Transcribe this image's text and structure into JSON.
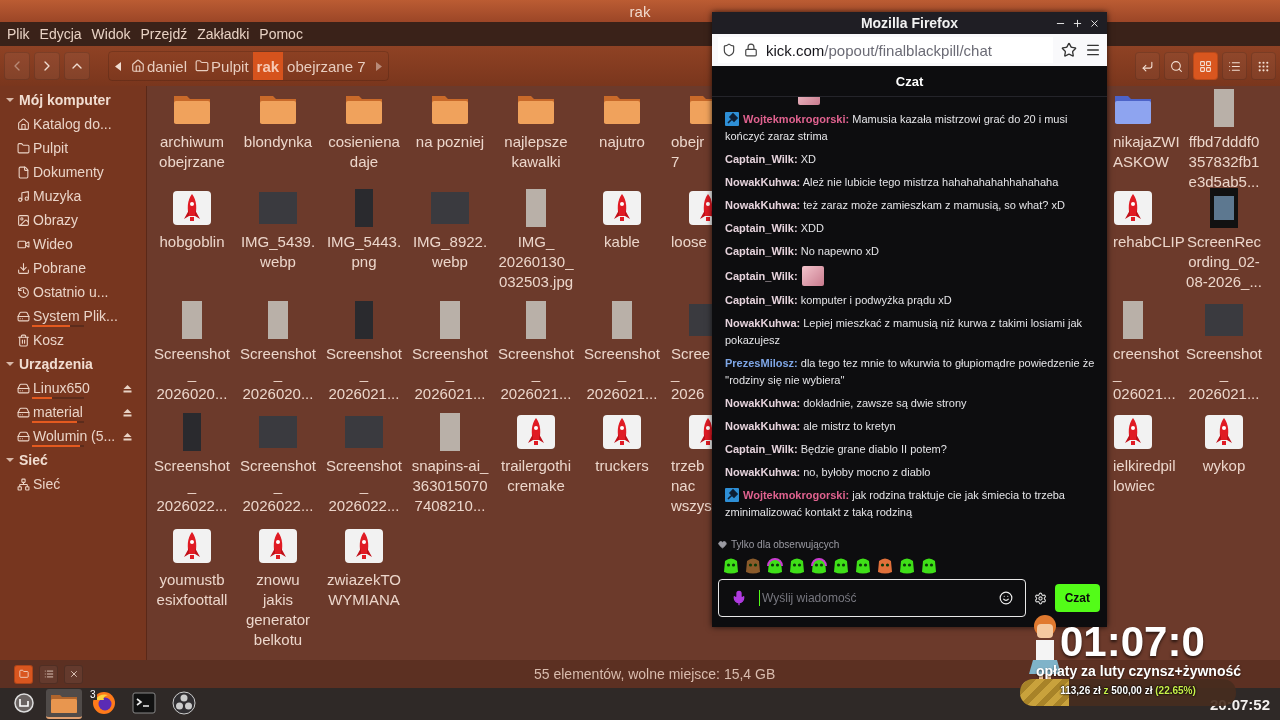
{
  "file_manager": {
    "title": "rak",
    "menu": [
      "Plik",
      "Edycja",
      "Widok",
      "Przejdź",
      "Zakładki",
      "Pomoc"
    ],
    "breadcrumb": [
      {
        "label": "daniel",
        "kind": "home",
        "selected": false
      },
      {
        "label": "Pulpit",
        "kind": "folder",
        "selected": false
      },
      {
        "label": "rak",
        "kind": "plain",
        "selected": true
      },
      {
        "label": "obejrzane 7",
        "kind": "plain",
        "selected": false
      }
    ],
    "view_modes": [
      {
        "kind": "grid",
        "selected": true
      },
      {
        "kind": "list",
        "selected": false
      },
      {
        "kind": "compact",
        "selected": false
      }
    ],
    "sidebar": [
      {
        "title": "Mój komputer",
        "expanded": true,
        "items": [
          {
            "label": "Katalog do...",
            "kind": "home"
          },
          {
            "label": "Pulpit",
            "kind": "folder"
          },
          {
            "label": "Dokumenty",
            "kind": "document"
          },
          {
            "label": "Muzyka",
            "kind": "music"
          },
          {
            "label": "Obrazy",
            "kind": "pictures"
          },
          {
            "label": "Wideo",
            "kind": "video"
          },
          {
            "label": "Pobrane",
            "kind": "downloads"
          },
          {
            "label": "Ostatnio u...",
            "kind": "recent"
          },
          {
            "label": "System Plik...",
            "kind": "filesystem",
            "level": 0.73
          },
          {
            "label": "Kosz",
            "kind": "trash"
          }
        ]
      },
      {
        "title": "Urządzenia",
        "expanded": true,
        "items": [
          {
            "label": "Linux650",
            "kind": "drive",
            "level": 0.38,
            "eject": true
          },
          {
            "label": "material",
            "kind": "drive",
            "level": 0.87,
            "eject": true
          },
          {
            "label": "Wolumin (5...",
            "kind": "drive",
            "level": 0.92,
            "eject": true
          }
        ]
      },
      {
        "title": "Sieć",
        "expanded": true,
        "items": [
          {
            "label": "Sieć",
            "kind": "network"
          }
        ]
      }
    ],
    "files_left": [
      {
        "kind": "folder",
        "lines": [
          "archiwum",
          "obejrzane"
        ]
      },
      {
        "kind": "folder",
        "lines": [
          "blondynka"
        ]
      },
      {
        "kind": "folder",
        "lines": [
          "cosieniena",
          "daje"
        ]
      },
      {
        "kind": "folder",
        "lines": [
          "na pozniej"
        ]
      },
      {
        "kind": "folder",
        "lines": [
          "najlepsze",
          "kawalki"
        ]
      },
      {
        "kind": "folder",
        "lines": [
          "najutro"
        ]
      },
      {
        "kind": "folder",
        "lines": [
          "obejr",
          "7"
        ]
      },
      {
        "kind": "rocket",
        "lines": [
          "hobgoblin"
        ]
      },
      {
        "kind": "photo_wide",
        "lines": [
          "IMG_5439.",
          "webp"
        ]
      },
      {
        "kind": "photo_dark",
        "lines": [
          "IMG_5443.",
          "png"
        ]
      },
      {
        "kind": "photo_wide",
        "lines": [
          "IMG_8922.",
          "webp"
        ]
      },
      {
        "kind": "photo",
        "lines": [
          "IMG_",
          "20260130_",
          "032503.jpg"
        ]
      },
      {
        "kind": "rocket",
        "lines": [
          "kable"
        ]
      },
      {
        "kind": "rocket",
        "lines": [
          "loose"
        ]
      },
      {
        "kind": "photo",
        "lines": [
          "Screenshot",
          "_",
          "2026020..."
        ]
      },
      {
        "kind": "photo",
        "lines": [
          "Screenshot",
          "_",
          "2026020..."
        ]
      },
      {
        "kind": "photo_dark",
        "lines": [
          "Screenshot",
          "_",
          "2026021..."
        ]
      },
      {
        "kind": "photo",
        "lines": [
          "Screenshot",
          "_",
          "2026021..."
        ]
      },
      {
        "kind": "photo",
        "lines": [
          "Screenshot",
          "_",
          "2026021..."
        ]
      },
      {
        "kind": "photo",
        "lines": [
          "Screenshot",
          "_",
          "2026021..."
        ]
      },
      {
        "kind": "photo_wide",
        "lines": [
          "Scree",
          "_",
          "2026"
        ]
      },
      {
        "kind": "photo_dark",
        "lines": [
          "Screenshot",
          "_",
          "2026022..."
        ]
      },
      {
        "kind": "photo_wide",
        "lines": [
          "Screenshot",
          "_",
          "2026022..."
        ]
      },
      {
        "kind": "photo_wide",
        "lines": [
          "Screenshot",
          "_",
          "2026022..."
        ]
      },
      {
        "kind": "photo",
        "lines": [
          "snapins-ai_",
          "363015070",
          "7408210..."
        ]
      },
      {
        "kind": "rocket",
        "lines": [
          "trailergothi",
          "cremake"
        ]
      },
      {
        "kind": "rocket",
        "lines": [
          "truckers"
        ]
      },
      {
        "kind": "rocket",
        "lines": [
          "trzeb",
          "nac",
          "wszys"
        ]
      },
      {
        "kind": "rocket",
        "lines": [
          "youmustb",
          "esixfoottall"
        ]
      },
      {
        "kind": "rocket",
        "lines": [
          "znowu",
          "jakis",
          "generator",
          "belkotu"
        ]
      },
      {
        "kind": "rocket",
        "lines": [
          "zwiazekTO",
          "WYMIANA"
        ]
      }
    ],
    "files_right": [
      {
        "kind": "folder_blue",
        "lines": [
          "nikajaZWI",
          "ASKOW"
        ]
      },
      {
        "kind": "photo",
        "lines": [
          "ffbd7dddf0",
          "357832fb1",
          "e3d5ab5..."
        ]
      },
      {
        "kind": "rocket",
        "lines": [
          "rehabCLIP"
        ]
      },
      {
        "kind": "video",
        "lines": [
          "ScreenRec",
          "ording_02-",
          "08-2026_..."
        ]
      },
      {
        "kind": "photo",
        "lines": [
          "creenshot",
          "_",
          "026021..."
        ]
      },
      {
        "kind": "photo_wide",
        "lines": [
          "Screenshot",
          "_",
          "2026021..."
        ]
      },
      {
        "kind": "rocket",
        "lines": [
          "ielkiredpil",
          "lowiec"
        ]
      },
      {
        "kind": "rocket",
        "lines": [
          "wykop"
        ]
      }
    ],
    "panel_buttons": [
      {
        "kind": "places",
        "selected": true
      },
      {
        "kind": "tree",
        "selected": false
      },
      {
        "kind": "hide",
        "selected": false
      }
    ],
    "status": "55 elementów, wolne miejsce: 15,4 GB"
  },
  "firefox": {
    "title": "Mozilla Firefox",
    "url": {
      "host": "kick.com",
      "path": "/popout/finalblackpill/chat"
    },
    "chat_title": "Czat",
    "messages": [
      {
        "kind": "clipped"
      },
      {
        "kind": "text",
        "user": "Wojtekmokrogorski:",
        "color": "#e0628f",
        "badge": true,
        "text": "Mamusia kazała mistrzowi grać do 20 i musi kończyć zaraz strima"
      },
      {
        "kind": "text",
        "user": "Captain_Wilk:",
        "color": "#e6d3dc",
        "badge": false,
        "text": "XD"
      },
      {
        "kind": "text",
        "user": "NowakKuhwa:",
        "color": "#e6d3dc",
        "badge": false,
        "text": "Ależ nie lubicie tego mistrza hahahahahahhahahaha"
      },
      {
        "kind": "text",
        "user": "NowakKuhwa:",
        "color": "#e6d3dc",
        "badge": false,
        "text": "też zaraz może zamieszkam z mamusią, so what? xD"
      },
      {
        "kind": "text",
        "user": "Captain_Wilk:",
        "color": "#e6d3dc",
        "badge": false,
        "text": "XDD"
      },
      {
        "kind": "text",
        "user": "Captain_Wilk:",
        "color": "#e6d3dc",
        "badge": false,
        "text": "No napewno xD"
      },
      {
        "kind": "emote",
        "user": "Captain_Wilk:",
        "color": "#e6d3dc"
      },
      {
        "kind": "text",
        "user": "Captain_Wilk:",
        "color": "#e6d3dc",
        "badge": false,
        "text": "komputer i podwyżka prądu xD"
      },
      {
        "kind": "text",
        "user": "NowakKuhwa:",
        "color": "#e6d3dc",
        "badge": false,
        "text": "Lepiej mieszkać z mamusią niż kurwa z takimi losiami jak pokazujesz"
      },
      {
        "kind": "text",
        "user": "PrezesMilosz:",
        "color": "#7ea6e6",
        "badge": false,
        "text": "dla tego tez mnie to wkurwia to głupiomądre powiedzenie że ''rodziny się nie wybiera''"
      },
      {
        "kind": "text",
        "user": "NowakKuhwa:",
        "color": "#e6d3dc",
        "badge": false,
        "text": "dokładnie, zawsze są dwie strony"
      },
      {
        "kind": "text",
        "user": "NowakKuhwa:",
        "color": "#e6d3dc",
        "badge": false,
        "text": "ale mistrz to kretyn"
      },
      {
        "kind": "text",
        "user": "Captain_Wilk:",
        "color": "#e6d3dc",
        "badge": false,
        "text": "Będzie grane diablo II potem?"
      },
      {
        "kind": "text",
        "user": "NowakKuhwa:",
        "color": "#e6d3dc",
        "badge": false,
        "text": "no, byłoby mocno z diablo"
      },
      {
        "kind": "text",
        "user": "Wojtekmokrogorski:",
        "color": "#e0628f",
        "badge": true,
        "text": "jak rodzina traktuje cie jak śmiecia to trzeba zminimalizować kontakt z taką rodziną"
      }
    ],
    "followers_only": "Tylko dla obserwujących",
    "emotes": [
      {
        "kind": "green"
      },
      {
        "kind": "brown"
      },
      {
        "kind": "headset"
      },
      {
        "kind": "green"
      },
      {
        "kind": "headset"
      },
      {
        "kind": "green"
      },
      {
        "kind": "green"
      },
      {
        "kind": "orange"
      },
      {
        "kind": "green"
      },
      {
        "kind": "green"
      }
    ],
    "input": {
      "placeholder": "Wyślij wiadomość"
    },
    "send": "Czat"
  },
  "stream_overlay": {
    "timer": "01:07:0",
    "goal_title": "opłaty za luty czynsz+żywność",
    "raised": "113,26 zł",
    "sep": "z",
    "goal": "500,00 zł",
    "percent": "(22.65%)",
    "level": 0.2265
  },
  "taskbar": {
    "apps": [
      {
        "kind": "menu",
        "selected": false
      },
      {
        "kind": "files",
        "selected": true
      },
      {
        "kind": "firefox",
        "selected": false,
        "badge": "3"
      },
      {
        "kind": "terminal",
        "selected": false
      },
      {
        "kind": "obs",
        "selected": false
      }
    ],
    "clock": "20:07:52"
  }
}
